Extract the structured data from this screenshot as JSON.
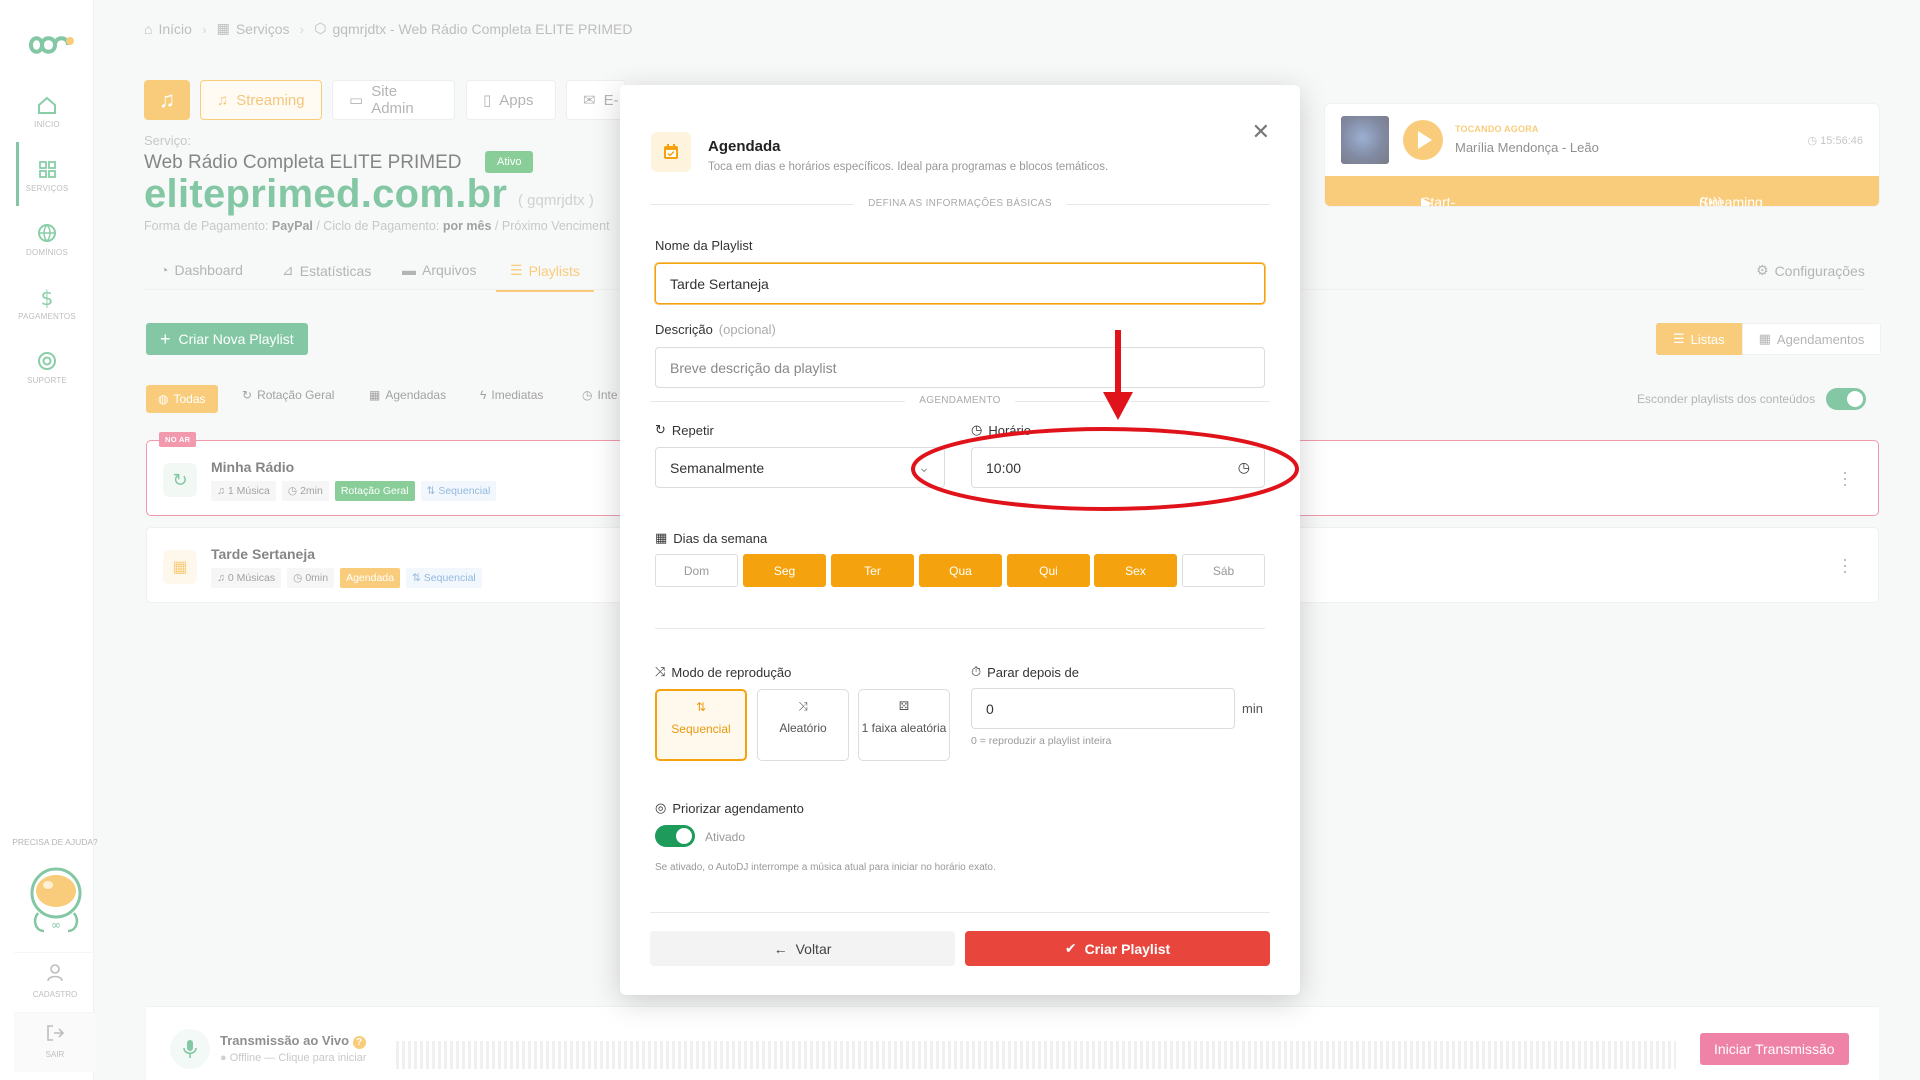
{
  "sidebar": {
    "items": [
      {
        "label": "Início",
        "icon": "home-icon"
      },
      {
        "label": "Serviços",
        "icon": "grid-icon"
      },
      {
        "label": "Domínios",
        "icon": "globe-icon"
      },
      {
        "label": "Pagamentos",
        "icon": "dollar-icon"
      },
      {
        "label": "Suporte",
        "icon": "lifebuoy-icon"
      }
    ],
    "help": "PRECISA DE AJUDA?",
    "account_label": "CADASTRO",
    "logout_label": "SAIR"
  },
  "breadcrumb": [
    "Início",
    "Serviços",
    "gqmrjdtx - Web Rádio Completa ELITE PRIMED"
  ],
  "service_tabs": [
    "Streaming",
    "Site Admin",
    "Apps",
    "E-"
  ],
  "service": {
    "label": "Serviço:",
    "name": "Web Rádio Completa ELITE PRIMED",
    "status": "Ativo",
    "domain": "eliteprimed.com.br",
    "id": "( gqmrjdtx )",
    "payment_prefix": "Forma de Pagamento: ",
    "payment_method": "PayPal",
    "cycle_prefix": " / Ciclo de Pagamento: ",
    "cycle": "por mês",
    "next_prefix": " / Próximo Venciment"
  },
  "main_tabs": [
    "Dashboard",
    "Estatísticas",
    "Arquivos",
    "Playlists"
  ],
  "config_label": "Configurações",
  "create_playlist": "Criar Nova Playlist",
  "filters": [
    "Todas",
    "Rotação Geral",
    "Agendadas",
    "Imediatas",
    "Inte"
  ],
  "view_toggle": [
    "Listas",
    "Agendamentos"
  ],
  "hide_label": "Esconder playlists dos conteúdos",
  "playlists": [
    {
      "badge": "NO AR",
      "title": "Minha Rádio",
      "songs": "1 Música",
      "duration": "2min",
      "type": "Rotação Geral",
      "mode": "Sequencial"
    },
    {
      "title": "Tarde Sertaneja",
      "songs": "0 Músicas",
      "duration": "0min",
      "type": "Agendada",
      "mode": "Sequencial"
    }
  ],
  "now_playing": {
    "label": "TOCANDO AGORA",
    "song": "Marília Mendonça - Leão",
    "time": "15:56:46",
    "links": [
      "Start-page",
      "Streaming"
    ]
  },
  "live": {
    "title": "Transmissão ao Vivo",
    "status": "Offline — Clique para iniciar",
    "button": "Iniciar Transmissão"
  },
  "modal": {
    "title": "Agendada",
    "subtitle": "Toca em dias e horários específicos. Ideal para programas e blocos temáticos.",
    "section_basic": "DEFINA AS INFORMAÇÕES BÁSICAS",
    "name_label": "Nome da Playlist",
    "name_value": "Tarde Sertaneja",
    "desc_label": "Descrição",
    "desc_optional": "(opcional)",
    "desc_placeholder": "Breve descrição da playlist",
    "section_schedule": "AGENDAMENTO",
    "repeat_label": "Repetir",
    "repeat_value": "Semanalmente",
    "time_label": "Horário",
    "time_value": "10:00",
    "days_label": "Dias da semana",
    "days": [
      {
        "label": "Dom",
        "on": false
      },
      {
        "label": "Seg",
        "on": true
      },
      {
        "label": "Ter",
        "on": true
      },
      {
        "label": "Qua",
        "on": true
      },
      {
        "label": "Qui",
        "on": true
      },
      {
        "label": "Sex",
        "on": true
      },
      {
        "label": "Sáb",
        "on": false
      }
    ],
    "mode_label": "Modo de reprodução",
    "modes": [
      {
        "label": "Sequencial",
        "on": true
      },
      {
        "label": "Aleatório",
        "on": false
      },
      {
        "label": "1 faixa aleatória",
        "on": false
      }
    ],
    "stop_label": "Parar depois de",
    "stop_value": "0",
    "stop_unit": "min",
    "stop_hint": "0 = reproduzir a playlist inteira",
    "priority_label": "Priorizar agendamento",
    "priority_state": "Ativado",
    "priority_hint": "Se ativado, o AutoDJ interrompe a música atual para iniciar no horário exato.",
    "back": "Voltar",
    "submit": "Criar Playlist"
  },
  "colors": {
    "accent": "#f4a30f",
    "brand": "#1e9a5a",
    "danger": "#e8453c",
    "onair": "#e8456b",
    "annotation": "#e0131b"
  }
}
